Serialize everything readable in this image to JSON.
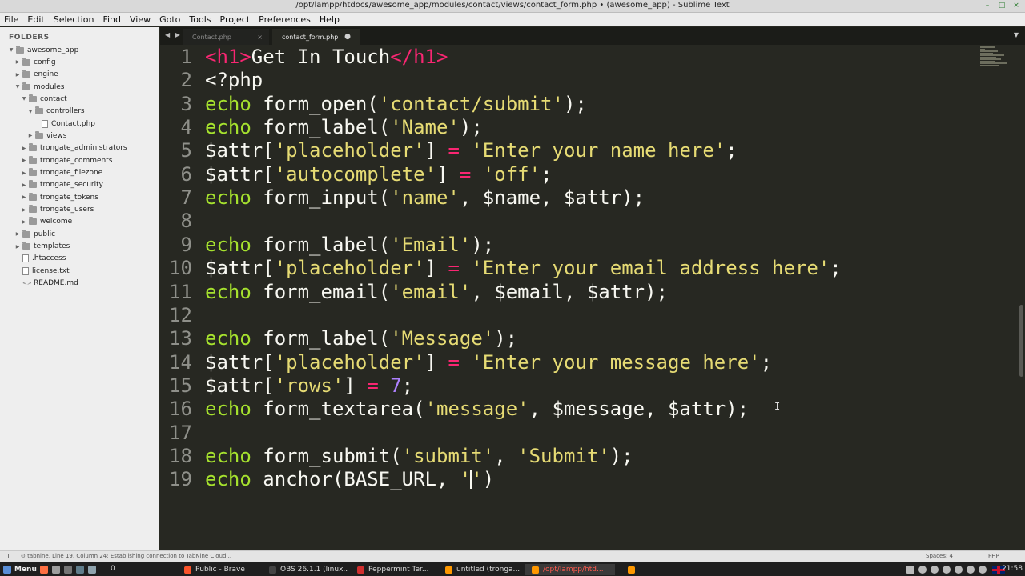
{
  "window": {
    "title": "/opt/lampp/htdocs/awesome_app/modules/contact/views/contact_form.php • (awesome_app) - Sublime Text"
  },
  "menu": [
    "File",
    "Edit",
    "Selection",
    "Find",
    "View",
    "Goto",
    "Tools",
    "Project",
    "Preferences",
    "Help"
  ],
  "sidebar": {
    "heading": "FOLDERS",
    "items": [
      {
        "label": "awesome_app",
        "type": "folder",
        "depth": 0,
        "expanded": true
      },
      {
        "label": "config",
        "type": "folder",
        "depth": 1,
        "expanded": false
      },
      {
        "label": "engine",
        "type": "folder",
        "depth": 1,
        "expanded": false
      },
      {
        "label": "modules",
        "type": "folder",
        "depth": 1,
        "expanded": true
      },
      {
        "label": "contact",
        "type": "folder",
        "depth": 2,
        "expanded": true
      },
      {
        "label": "controllers",
        "type": "folder",
        "depth": 3,
        "expanded": true
      },
      {
        "label": "Contact.php",
        "type": "file",
        "depth": 4
      },
      {
        "label": "views",
        "type": "folder",
        "depth": 3,
        "expanded": false
      },
      {
        "label": "trongate_administrators",
        "type": "folder",
        "depth": 2,
        "expanded": false
      },
      {
        "label": "trongate_comments",
        "type": "folder",
        "depth": 2,
        "expanded": false
      },
      {
        "label": "trongate_filezone",
        "type": "folder",
        "depth": 2,
        "expanded": false
      },
      {
        "label": "trongate_security",
        "type": "folder",
        "depth": 2,
        "expanded": false
      },
      {
        "label": "trongate_tokens",
        "type": "folder",
        "depth": 2,
        "expanded": false
      },
      {
        "label": "trongate_users",
        "type": "folder",
        "depth": 2,
        "expanded": false
      },
      {
        "label": "welcome",
        "type": "folder",
        "depth": 2,
        "expanded": false
      },
      {
        "label": "public",
        "type": "folder",
        "depth": 1,
        "expanded": false
      },
      {
        "label": "templates",
        "type": "folder",
        "depth": 1,
        "expanded": false
      },
      {
        "label": ".htaccess",
        "type": "file",
        "depth": 1
      },
      {
        "label": "license.txt",
        "type": "file",
        "depth": 1
      },
      {
        "label": "README.md",
        "type": "code",
        "depth": 1
      }
    ]
  },
  "tabs": {
    "nav": "◀ ▶",
    "inactive_label": "Contact.php",
    "inactive_close": "×",
    "active_label": "contact_form.php",
    "active_dirty": "●",
    "menu": "▼"
  },
  "editor": {
    "lines": [
      {
        "n": "1",
        "tokens": [
          [
            "tag",
            "<h1>"
          ],
          [
            "fn",
            "Get In Touch"
          ],
          [
            "tag",
            "</h1>"
          ]
        ]
      },
      {
        "n": "2",
        "tokens": [
          [
            "fn",
            "<?php"
          ]
        ]
      },
      {
        "n": "3",
        "tokens": [
          [
            "kw",
            "echo"
          ],
          [
            "fn",
            " form_open("
          ],
          [
            "str",
            "'contact/submit'"
          ],
          [
            "fn",
            ");"
          ]
        ]
      },
      {
        "n": "4",
        "tokens": [
          [
            "kw",
            "echo"
          ],
          [
            "fn",
            " form_label("
          ],
          [
            "str",
            "'Name'"
          ],
          [
            "fn",
            ");"
          ]
        ]
      },
      {
        "n": "5",
        "tokens": [
          [
            "var",
            "$attr["
          ],
          [
            "str",
            "'placeholder'"
          ],
          [
            "var",
            "] "
          ],
          [
            "op",
            "="
          ],
          [
            "var",
            " "
          ],
          [
            "str",
            "'Enter your name here'"
          ],
          [
            "var",
            ";"
          ]
        ]
      },
      {
        "n": "6",
        "tokens": [
          [
            "var",
            "$attr["
          ],
          [
            "str",
            "'autocomplete'"
          ],
          [
            "var",
            "] "
          ],
          [
            "op",
            "="
          ],
          [
            "var",
            " "
          ],
          [
            "str",
            "'off'"
          ],
          [
            "var",
            ";"
          ]
        ]
      },
      {
        "n": "7",
        "tokens": [
          [
            "kw",
            "echo"
          ],
          [
            "fn",
            " form_input("
          ],
          [
            "str",
            "'name'"
          ],
          [
            "fn",
            ", $name, $attr);"
          ]
        ]
      },
      {
        "n": "8",
        "tokens": []
      },
      {
        "n": "9",
        "tokens": [
          [
            "kw",
            "echo"
          ],
          [
            "fn",
            " form_label("
          ],
          [
            "str",
            "'Email'"
          ],
          [
            "fn",
            ");"
          ]
        ]
      },
      {
        "n": "10",
        "tokens": [
          [
            "var",
            "$attr["
          ],
          [
            "str",
            "'placeholder'"
          ],
          [
            "var",
            "] "
          ],
          [
            "op",
            "="
          ],
          [
            "var",
            " "
          ],
          [
            "str",
            "'Enter your email address here'"
          ],
          [
            "var",
            ";"
          ]
        ]
      },
      {
        "n": "11",
        "tokens": [
          [
            "kw",
            "echo"
          ],
          [
            "fn",
            " form_email("
          ],
          [
            "str",
            "'email'"
          ],
          [
            "fn",
            ", $email, $attr);"
          ]
        ]
      },
      {
        "n": "12",
        "tokens": []
      },
      {
        "n": "13",
        "tokens": [
          [
            "kw",
            "echo"
          ],
          [
            "fn",
            " form_label("
          ],
          [
            "str",
            "'Message'"
          ],
          [
            "fn",
            ");"
          ]
        ]
      },
      {
        "n": "14",
        "tokens": [
          [
            "var",
            "$attr["
          ],
          [
            "str",
            "'placeholder'"
          ],
          [
            "var",
            "] "
          ],
          [
            "op",
            "="
          ],
          [
            "var",
            " "
          ],
          [
            "str",
            "'Enter your message here'"
          ],
          [
            "var",
            ";"
          ]
        ]
      },
      {
        "n": "15",
        "tokens": [
          [
            "var",
            "$attr["
          ],
          [
            "str",
            "'rows'"
          ],
          [
            "var",
            "] "
          ],
          [
            "op",
            "="
          ],
          [
            "var",
            " "
          ],
          [
            "num",
            "7"
          ],
          [
            "var",
            ";"
          ]
        ]
      },
      {
        "n": "16",
        "tokens": [
          [
            "kw",
            "echo"
          ],
          [
            "fn",
            " form_textarea("
          ],
          [
            "str",
            "'message'"
          ],
          [
            "fn",
            ", $message, $attr);"
          ]
        ]
      },
      {
        "n": "17",
        "tokens": []
      },
      {
        "n": "18",
        "tokens": [
          [
            "kw",
            "echo"
          ],
          [
            "fn",
            " form_submit("
          ],
          [
            "str",
            "'submit'"
          ],
          [
            "fn",
            ", "
          ],
          [
            "str",
            "'Submit'"
          ],
          [
            "fn",
            ");"
          ]
        ]
      },
      {
        "n": "19",
        "tokens": [
          [
            "kw",
            "echo"
          ],
          [
            "fn",
            " anchor(BASE_URL, "
          ],
          [
            "str",
            "'"
          ],
          [
            "cursor",
            ""
          ],
          [
            "str",
            "'"
          ],
          [
            "fn",
            ")"
          ]
        ]
      }
    ],
    "ibeam": "I"
  },
  "statusbar": {
    "left": "⊙ tabnine, Line 19, Column 24; Establishing connection to TabNine Cloud...",
    "spaces": "Spaces: 4",
    "syntax": "PHP"
  },
  "taskbar": {
    "start": "Menu",
    "workspace": "0",
    "tasks": [
      {
        "label": "Public - Brave",
        "color": "#fb542b",
        "active": false
      },
      {
        "label": "OBS 26.1.1 (linux...",
        "color": "#444444",
        "active": false
      },
      {
        "label": "Peppermint Ter...",
        "color": "#d12f2f",
        "active": false
      },
      {
        "label": "untitled (tronga...",
        "color": "#ff9800",
        "active": false
      },
      {
        "label": "/opt/lampp/htd...",
        "color": "#ff9800",
        "active": true
      }
    ],
    "clock": "21:58"
  },
  "colors": {
    "editor_bg": "#272822",
    "keyword": "#a6e22e",
    "string": "#e6db74",
    "tag": "#f92672",
    "number": "#ae81ff"
  }
}
